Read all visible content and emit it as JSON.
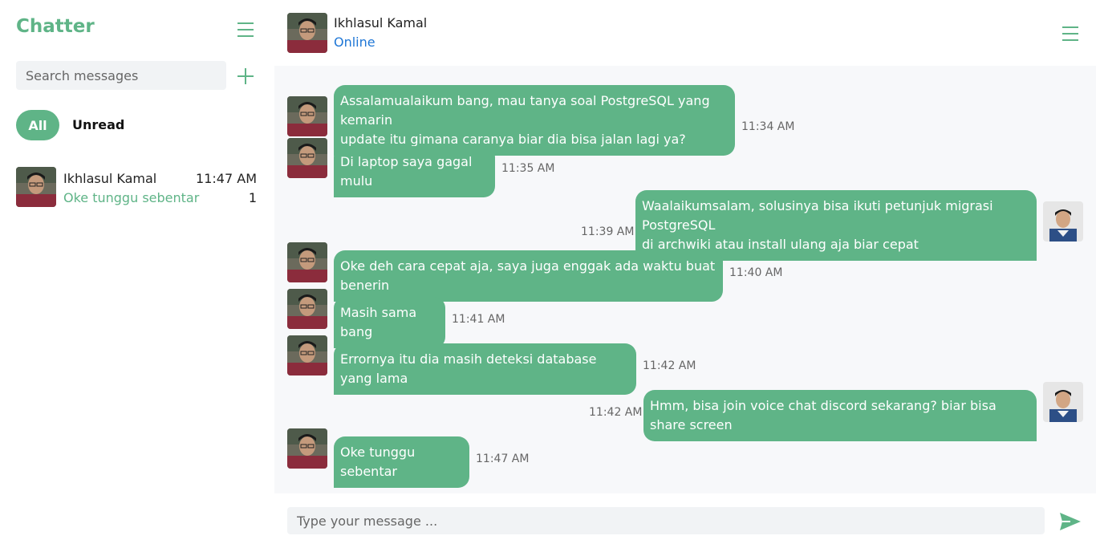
{
  "brand": "Chatter",
  "search": {
    "placeholder": "Search messages"
  },
  "filters": {
    "all": "All",
    "unread": "Unread"
  },
  "conversations": [
    {
      "name": "Ikhlasul Kamal",
      "time": "11:47 AM",
      "preview": "Oke tunggu sebentar",
      "unread": "1"
    }
  ],
  "chat": {
    "name": "Ikhlasul Kamal",
    "status": "Online"
  },
  "messages": [
    {
      "from": "them",
      "lines": [
        "Assalamualaikum bang, mau tanya soal PostgreSQL yang kemarin",
        "update itu gimana caranya biar dia bisa jalan lagi ya?"
      ],
      "time": "11:34 AM"
    },
    {
      "from": "them",
      "lines": [
        "Di laptop saya gagal mulu"
      ],
      "time": "11:35 AM"
    },
    {
      "from": "me",
      "lines": [
        "Waalaikumsalam, solusinya bisa ikuti petunjuk migrasi PostgreSQL",
        "di archwiki atau install ulang aja biar cepat"
      ],
      "time": "11:39 AM"
    },
    {
      "from": "them",
      "lines": [
        "Oke deh cara cepat aja, saya juga enggak ada waktu buat benerin"
      ],
      "time": "11:40 AM"
    },
    {
      "from": "them",
      "lines": [
        "Masih sama bang"
      ],
      "time": "11:41 AM"
    },
    {
      "from": "them",
      "lines": [
        "Errornya itu dia masih deteksi database yang lama"
      ],
      "time": "11:42 AM"
    },
    {
      "from": "me",
      "lines": [
        "Hmm, bisa join voice chat discord sekarang? biar bisa share screen"
      ],
      "time": "11:42 AM"
    },
    {
      "from": "them",
      "lines": [
        "Oke tunggu sebentar"
      ],
      "time": "11:47 AM"
    }
  ],
  "composer": {
    "placeholder": "Type your message ..."
  },
  "icons": {
    "menu": "hamburger-menu-icon",
    "add": "plus-icon",
    "send": "send-arrow-icon"
  },
  "colors": {
    "accent": "#5fb487",
    "online": "#1e76d6",
    "chat_bg": "#f7f8fa"
  }
}
